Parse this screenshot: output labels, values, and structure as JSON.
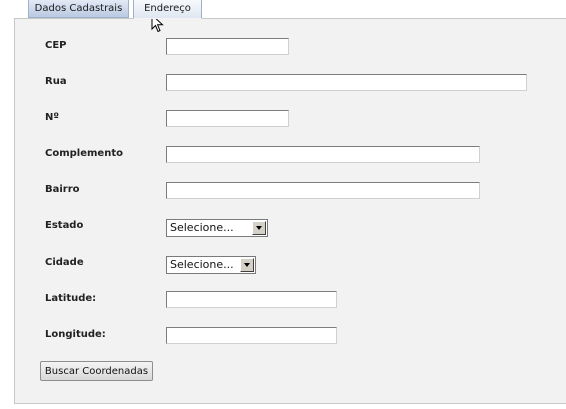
{
  "tabs": [
    {
      "label": "Dados Cadastrais",
      "active": false
    },
    {
      "label": "Endereço",
      "active": true
    }
  ],
  "form": {
    "cep": {
      "label": "CEP",
      "value": ""
    },
    "rua": {
      "label": "Rua",
      "value": ""
    },
    "numero": {
      "label": "Nº",
      "value": ""
    },
    "complemento": {
      "label": "Complemento",
      "value": ""
    },
    "bairro": {
      "label": "Bairro",
      "value": ""
    },
    "estado": {
      "label": "Estado",
      "selected": "Selecione..."
    },
    "cidade": {
      "label": "Cidade",
      "selected": "Selecione..."
    },
    "latitude": {
      "label": "Latitude:",
      "value": ""
    },
    "longitude": {
      "label": "Longitude:",
      "value": ""
    }
  },
  "buttons": {
    "buscar": "Buscar Coordenadas"
  },
  "colors": {
    "panel_background": "#f2f2f2",
    "tab_active": "#dfe7f2",
    "tab_inactive": "#b9c9e2"
  },
  "icons": {
    "cursor": "mouse-pointer-icon",
    "dropdown": "chevron-down-icon"
  }
}
